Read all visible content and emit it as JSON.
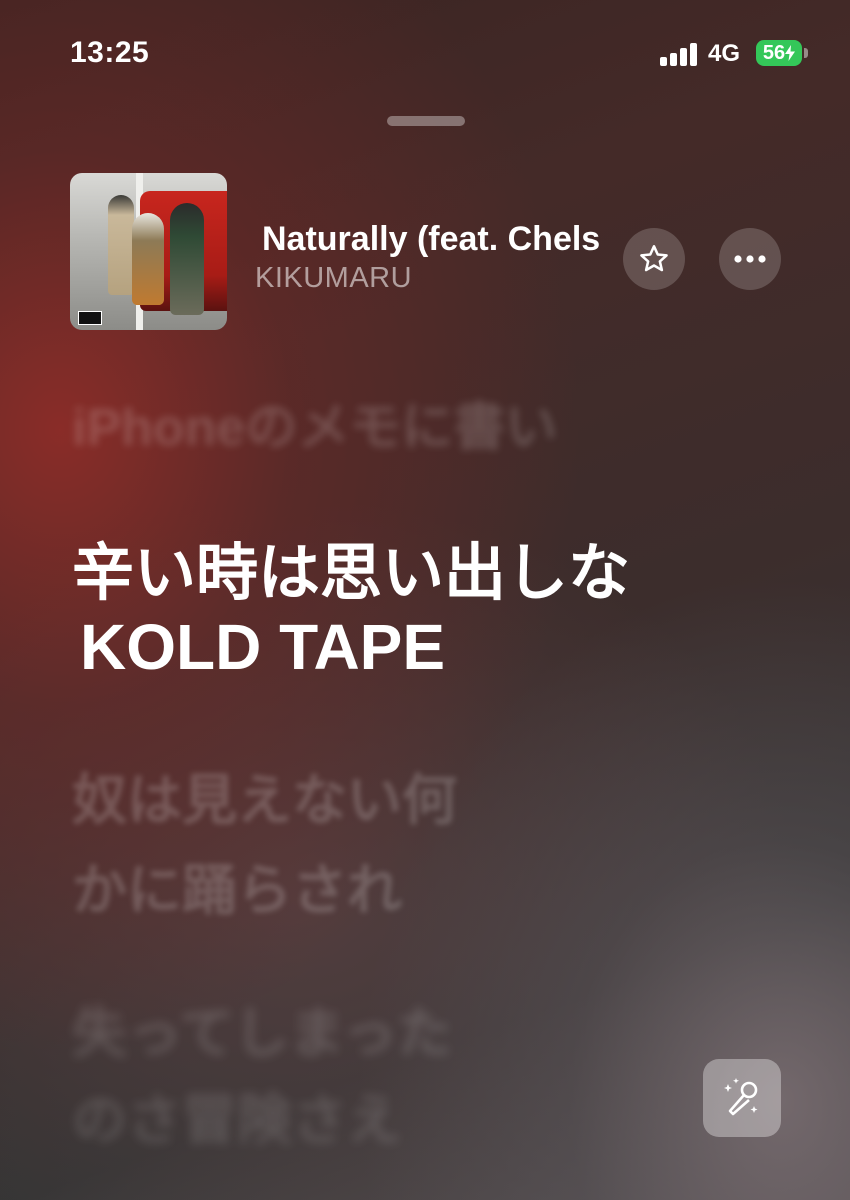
{
  "status_bar": {
    "time": "13:25",
    "network": "4G",
    "battery": "56",
    "battery_color": "#34c759"
  },
  "now_playing": {
    "title": "Naturally (feat. Chels",
    "artist": "KIKUMARU",
    "artwork_icon": "album-artwork",
    "favorite_icon": "star-icon",
    "more_icon": "ellipsis-icon"
  },
  "lyrics": {
    "previous": "iPhoneのメモに書い",
    "current": [
      "辛い時は思い出しな",
      "KOLD TAPE"
    ],
    "next": [
      "奴は見えない何",
      "かに踊らされ"
    ],
    "later": [
      "失ってしまった",
      "のさ冒険さえ"
    ]
  },
  "controls": {
    "sing_icon": "microphone-sparkle-icon"
  }
}
